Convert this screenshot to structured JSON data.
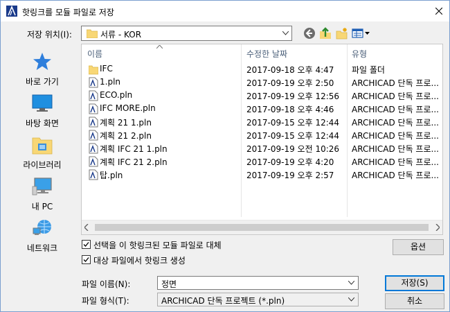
{
  "window": {
    "title": "핫링크를 모듈 파일로 저장",
    "icons": {
      "app": "archicad-icon",
      "close": "close-icon"
    }
  },
  "location": {
    "label": "저장 위치(I):",
    "value": "서류 - KOR",
    "icons": [
      "back-icon",
      "up-folder-icon",
      "new-folder-icon",
      "view-menu-icon"
    ]
  },
  "places": [
    {
      "label": "바로 가기",
      "icon": "star-icon"
    },
    {
      "label": "바탕 화면",
      "icon": "desktop-icon"
    },
    {
      "label": "라이브러리",
      "icon": "library-icon"
    },
    {
      "label": "내 PC",
      "icon": "computer-icon"
    },
    {
      "label": "네트워크",
      "icon": "network-icon"
    }
  ],
  "columns": [
    "이름",
    "수정한 날짜",
    "유형"
  ],
  "files": [
    {
      "name": "IFC",
      "date": "2017-09-18 오후 4:47",
      "type": "파일 폴더",
      "icon": "folder-icon"
    },
    {
      "name": "1.pln",
      "date": "2017-09-19 오후 2:50",
      "type": "ARCHICAD 단독 프로...",
      "icon": "pln-file-icon"
    },
    {
      "name": "ECO.pln",
      "date": "2017-09-19 오후 12:56",
      "type": "ARCHICAD 단독 프로...",
      "icon": "pln-file-icon"
    },
    {
      "name": "IFC MORE.pln",
      "date": "2017-09-18 오후 4:46",
      "type": "ARCHICAD 단독 프로...",
      "icon": "pln-file-icon"
    },
    {
      "name": "계획 21 1.pln",
      "date": "2017-09-15 오후 12:44",
      "type": "ARCHICAD 단독 프로...",
      "icon": "pln-file-icon"
    },
    {
      "name": "계획 21 2.pln",
      "date": "2017-09-15 오후 12:44",
      "type": "ARCHICAD 단독 프로...",
      "icon": "pln-file-icon"
    },
    {
      "name": "계획 IFC 21 1.pln",
      "date": "2017-09-19 오전 10:26",
      "type": "ARCHICAD 단독 프로...",
      "icon": "pln-file-icon"
    },
    {
      "name": "계획 IFC 21 2.pln",
      "date": "2017-09-19 오후 4:20",
      "type": "ARCHICAD 단독 프로...",
      "icon": "pln-file-icon"
    },
    {
      "name": "탑.pln",
      "date": "2017-09-19 오후 2:57",
      "type": "ARCHICAD 단독 프로...",
      "icon": "pln-file-icon"
    }
  ],
  "options": {
    "replace": {
      "label": "선택을 이 핫링크된 모듈 파일로 대체",
      "checked": true
    },
    "create": {
      "label": "대상 파일에서 핫링크 생성",
      "checked": true
    },
    "options_button": "옵션"
  },
  "filename": {
    "label": "파일 이름(N):",
    "value": "정면"
  },
  "filetype": {
    "label": "파일 형식(T):",
    "value": "ARCHICAD 단독 프로젝트 (*.pln)"
  },
  "buttons": {
    "save": "저장(S)",
    "cancel": "취소"
  },
  "colors": {
    "accent": "#0078d7",
    "folder": "#f8d775",
    "header_text": "#4c607a"
  }
}
